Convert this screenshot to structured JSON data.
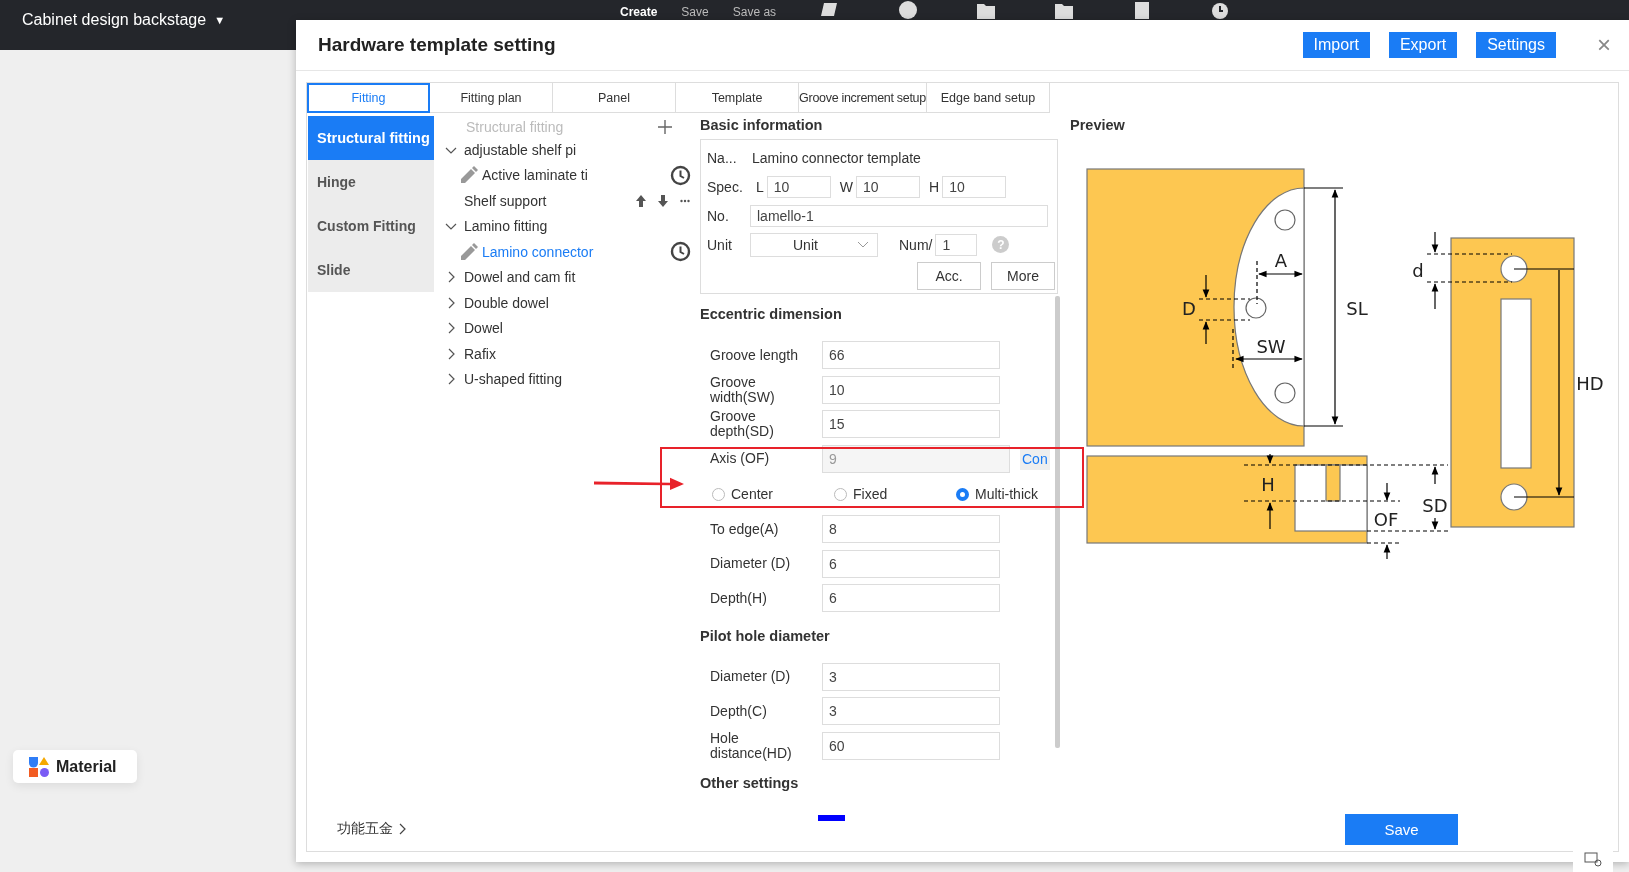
{
  "app_bar": {
    "title": "Cabinet design backstage",
    "caret": "▼",
    "actions": [
      "Create",
      "Save",
      "Save as"
    ]
  },
  "dialog": {
    "title": "Hardware template setting",
    "buttons": [
      "Import",
      "Export",
      "Settings"
    ],
    "close": "×"
  },
  "tabs": [
    {
      "label": "Fitting",
      "selected": true
    },
    {
      "label": "Fitting plan",
      "selected": false
    },
    {
      "label": "Panel",
      "selected": false
    },
    {
      "label": "Template",
      "selected": false
    },
    {
      "label": "Groove increment setup",
      "selected": false
    },
    {
      "label": "Edge band setup",
      "selected": false
    }
  ],
  "categories": [
    {
      "label": "Structural fitting",
      "selected": true
    },
    {
      "label": "Hinge",
      "selected": false
    },
    {
      "label": "Custom Fitting",
      "selected": false
    },
    {
      "label": "Slide",
      "selected": false
    }
  ],
  "tree": {
    "header": "Structural fitting",
    "items": [
      {
        "label": "adjustable shelf pi",
        "expanded": true,
        "children": [
          {
            "kind": "template",
            "label": "Active laminate ti",
            "selected": false
          },
          {
            "kind": "item",
            "label": "Shelf support",
            "selected": false
          }
        ]
      },
      {
        "label": "Lamino fitting",
        "expanded": true,
        "children": [
          {
            "kind": "template",
            "label": "Lamino connector",
            "selected": true
          }
        ]
      },
      {
        "label": "Dowel and cam fit",
        "expanded": false
      },
      {
        "label": "Double dowel",
        "expanded": false
      },
      {
        "label": "Dowel",
        "expanded": false
      },
      {
        "label": "Rafix",
        "expanded": false
      },
      {
        "label": "U-shaped fitting",
        "expanded": false
      }
    ]
  },
  "basic": {
    "heading": "Basic information",
    "name_label": "Na...",
    "name_value": "Lamino connector template",
    "spec_label": "Spec.",
    "spec": [
      {
        "label": "L",
        "value": "10"
      },
      {
        "label": "W",
        "value": "10"
      },
      {
        "label": "H",
        "value": "10"
      }
    ],
    "no_label": "No.",
    "no_value": "lamello-1",
    "unit_label": "Unit",
    "unit_value": "Unit",
    "num_label": "Num/",
    "num_value": "1",
    "help": "?",
    "buttons": [
      "Acc.",
      "More"
    ]
  },
  "sections": [
    {
      "heading": "Eccentric dimension",
      "rows": [
        {
          "kind": "field",
          "label": "Groove length",
          "value": "66",
          "disabled": false
        },
        {
          "kind": "field",
          "label": "Groove width(SW)",
          "value": "10",
          "disabled": false
        },
        {
          "kind": "field",
          "label": "Groove depth(SD)",
          "value": "15",
          "disabled": false
        },
        {
          "kind": "field",
          "label": "Axis (OF)",
          "value": "9",
          "disabled": true,
          "link": "Con"
        },
        {
          "kind": "radios",
          "options": [
            {
              "label": "Center",
              "selected": false
            },
            {
              "label": "Fixed",
              "selected": false
            },
            {
              "label": "Multi-thick",
              "selected": true
            }
          ]
        },
        {
          "kind": "field",
          "label": "To edge(A)",
          "value": "8",
          "disabled": false
        },
        {
          "kind": "field",
          "label": "Diameter (D)",
          "value": "6",
          "disabled": false
        },
        {
          "kind": "field",
          "label": "Depth(H)",
          "value": "6",
          "disabled": false
        }
      ]
    },
    {
      "heading": "Pilot hole diameter",
      "rows": [
        {
          "kind": "field",
          "label": "Diameter (D)",
          "value": "3",
          "disabled": false
        },
        {
          "kind": "field",
          "label": "Depth(C)",
          "value": "3",
          "disabled": false
        },
        {
          "kind": "field",
          "label": "Hole distance(HD)",
          "value": "60",
          "disabled": false
        }
      ]
    },
    {
      "heading": "Other settings",
      "rows": [
        {
          "kind": "swatch",
          "color": "#0000ff"
        }
      ]
    }
  ],
  "preview": {
    "heading": "Preview",
    "labels": [
      "A",
      "D",
      "SW",
      "SL",
      "d",
      "HD",
      "H",
      "OF",
      "SD"
    ]
  },
  "footer": {
    "link": "功能五金",
    "save": "Save"
  },
  "material": {
    "label": "Material"
  }
}
